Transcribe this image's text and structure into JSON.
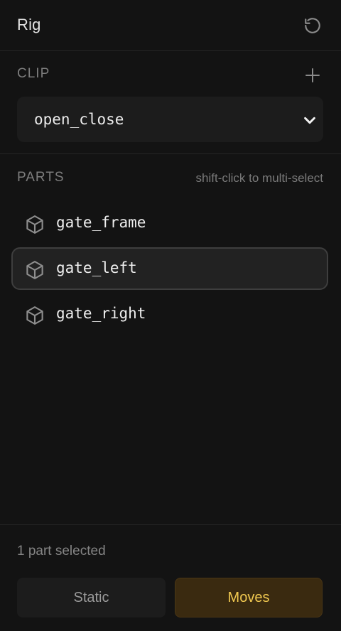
{
  "header": {
    "title": "Rig",
    "reset_icon": "reset-icon"
  },
  "clip": {
    "label": "CLIP",
    "add_icon": "plus-icon",
    "selected": "open_close",
    "dropdown_icon": "chevron-down-icon"
  },
  "parts": {
    "label": "PARTS",
    "hint": "shift-click to multi-select",
    "items": [
      {
        "name": "gate_frame",
        "icon": "cube-icon",
        "selected": false
      },
      {
        "name": "gate_left",
        "icon": "cube-icon",
        "selected": true
      },
      {
        "name": "gate_right",
        "icon": "cube-icon",
        "selected": false
      }
    ]
  },
  "footer": {
    "status": "1 part selected",
    "static_label": "Static",
    "moves_label": "Moves",
    "active": "Moves"
  },
  "colors": {
    "background": "#131313",
    "accent_bg": "#3a2a10",
    "accent_text": "#f0c850"
  }
}
